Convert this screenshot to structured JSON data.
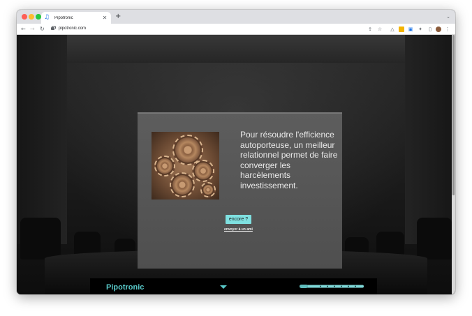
{
  "browser": {
    "tab_title": "Pipotronic",
    "tab_icon": "music-note-icon",
    "new_tab_label": "+",
    "url": "pipotronic.com"
  },
  "page": {
    "message": "Pour résoudre l'efficience autoporteuse, un meilleur relationnel permet de faire converger les harcèlements investissement.",
    "encore_label": "encore ?",
    "send_link_label": "envoyer à un ami",
    "brand": "Pipotronic",
    "accent_color": "#7fe0e0"
  }
}
